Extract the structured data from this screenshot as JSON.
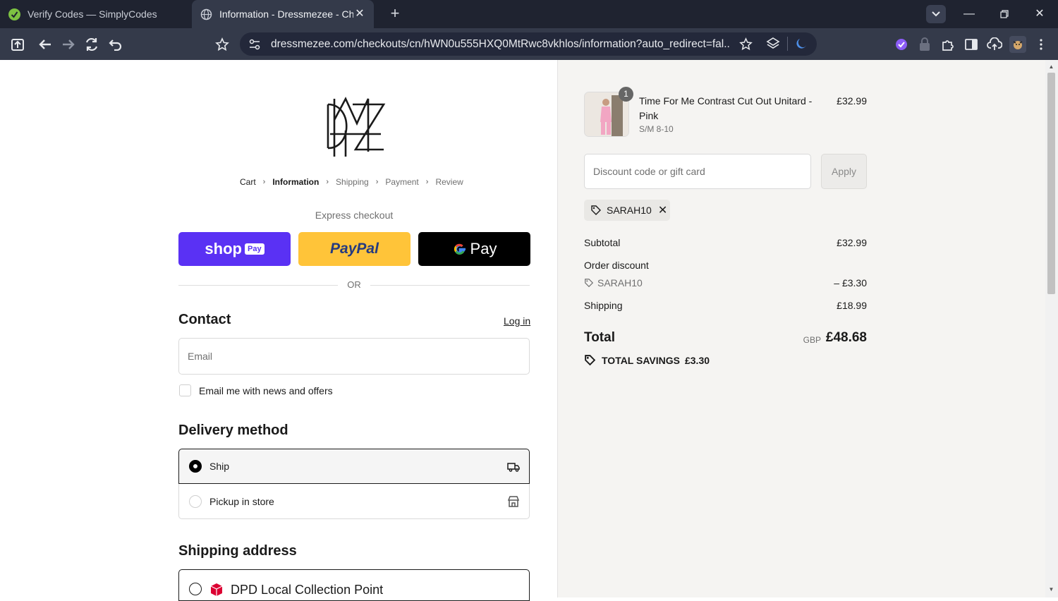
{
  "browser": {
    "tabs": [
      {
        "title": "Verify Codes — SimplyCodes",
        "favicon": "simplycodes-icon",
        "active": false
      },
      {
        "title": "Information - Dressmezee - Checkout",
        "favicon": "globe-icon",
        "active": true
      }
    ],
    "url": "dressmezee.com/checkouts/cn/hWN0u555HXQ0MtRwc8vkhlos/information?auto_redirect=fal..."
  },
  "checkout": {
    "breadcrumb": [
      {
        "label": "Cart",
        "state": "link"
      },
      {
        "label": "Information",
        "state": "current"
      },
      {
        "label": "Shipping",
        "state": "upcoming"
      },
      {
        "label": "Payment",
        "state": "upcoming"
      },
      {
        "label": "Review",
        "state": "upcoming"
      }
    ],
    "express_label": "Express checkout",
    "express": {
      "shop": "shop",
      "shop_badge": "Pay",
      "paypal": "PayPal",
      "gpay": "Pay"
    },
    "or": "OR",
    "contact": {
      "heading": "Contact",
      "login": "Log in",
      "email_placeholder": "Email",
      "newsletter_label": "Email me with news and offers",
      "newsletter_checked": false
    },
    "delivery": {
      "heading": "Delivery method",
      "options": [
        {
          "label": "Ship",
          "selected": true,
          "icon": "truck-icon"
        },
        {
          "label": "Pickup in store",
          "selected": false,
          "icon": "store-icon"
        }
      ]
    },
    "shipping_address": {
      "heading": "Shipping address",
      "option": "DPD Local Collection Point"
    }
  },
  "summary": {
    "item": {
      "quantity": "1",
      "name": "Time For Me Contrast Cut Out Unitard - Pink",
      "variant": "S/M 8-10",
      "price": "£32.99"
    },
    "discount_placeholder": "Discount code or gift card",
    "apply_label": "Apply",
    "applied_code": "SARAH10",
    "subtotal_label": "Subtotal",
    "subtotal_value": "£32.99",
    "order_discount_label": "Order discount",
    "discount_code": "SARAH10",
    "discount_value": "– £3.30",
    "shipping_label": "Shipping",
    "shipping_value": "£18.99",
    "total_label": "Total",
    "total_currency": "GBP",
    "total_value": "£48.68",
    "savings_label": "TOTAL SAVINGS",
    "savings_value": "£3.30"
  },
  "colors": {
    "shop_pay": "#5a31f4",
    "paypal": "#ffc439",
    "gpay": "#000000",
    "summary_bg": "#f5f4f2"
  }
}
